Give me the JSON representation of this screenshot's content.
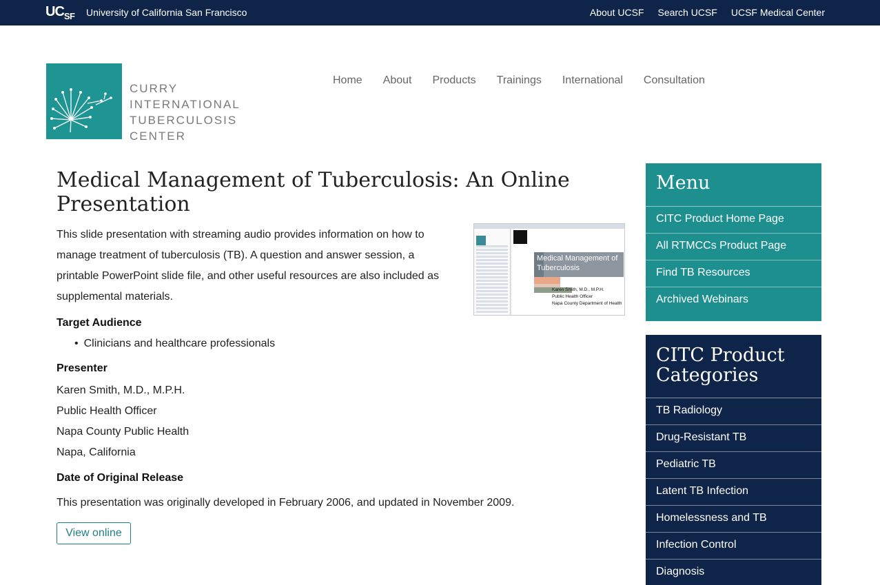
{
  "ucsf_bar": {
    "logo": "UCSF",
    "university_name": "University of California San Francisco",
    "links": [
      "About UCSF",
      "Search UCSF",
      "UCSF Medical Center"
    ]
  },
  "brand": {
    "logo_icon": "dandelion-logo-icon",
    "name_lines": [
      "CURRY",
      "INTERNATIONAL",
      "TUBERCULOSIS",
      "CENTER"
    ]
  },
  "main_nav": [
    "Home",
    "About",
    "Products",
    "Trainings",
    "International",
    "Consultation"
  ],
  "content": {
    "title": "Medical Management of Tuberculosis: An Online Presentation",
    "intro": "This slide presentation with streaming audio provides information on how to manage treatment of tuberculosis (TB). A question and answer session, a printable PowerPoint slide file, and other useful resources are also included as supplemental materials.",
    "thumbnail": {
      "slide_title": "Medical Management of Tuberculosis",
      "slide_lines": [
        "Karen Smith, M.D., M.P.H.",
        "Public Health Officer",
        "Napa County Department of Health"
      ]
    },
    "target_audience_heading": "Target Audience",
    "target_audience_items": [
      "Clinicians and healthcare professionals"
    ],
    "presenter_heading": "Presenter",
    "presenter_lines": [
      "Karen Smith, M.D., M.P.H.",
      "Public Health Officer",
      "Napa County Public Health",
      "Napa, California"
    ],
    "release_heading": "Date of Original Release",
    "release_text": "This presentation was originally developed in February 2006, and updated in November 2009.",
    "view_button": "View online"
  },
  "sidebar": {
    "menu_title": "Menu",
    "menu_items": [
      "CITC Product Home Page",
      "All RTMCCs Product Page",
      "Find TB Resources",
      "Archived Webinars"
    ],
    "categories_title": "CITC Product Categories",
    "category_items": [
      "TB Radiology",
      "Drug-Resistant TB",
      "Pediatric TB",
      "Latent TB Infection",
      "Homelessness and TB",
      "Infection Control",
      "Diagnosis"
    ]
  },
  "colors": {
    "navy": "#0f2449",
    "teal": "#1e8f8f",
    "brand_teal": "#1f9593"
  }
}
